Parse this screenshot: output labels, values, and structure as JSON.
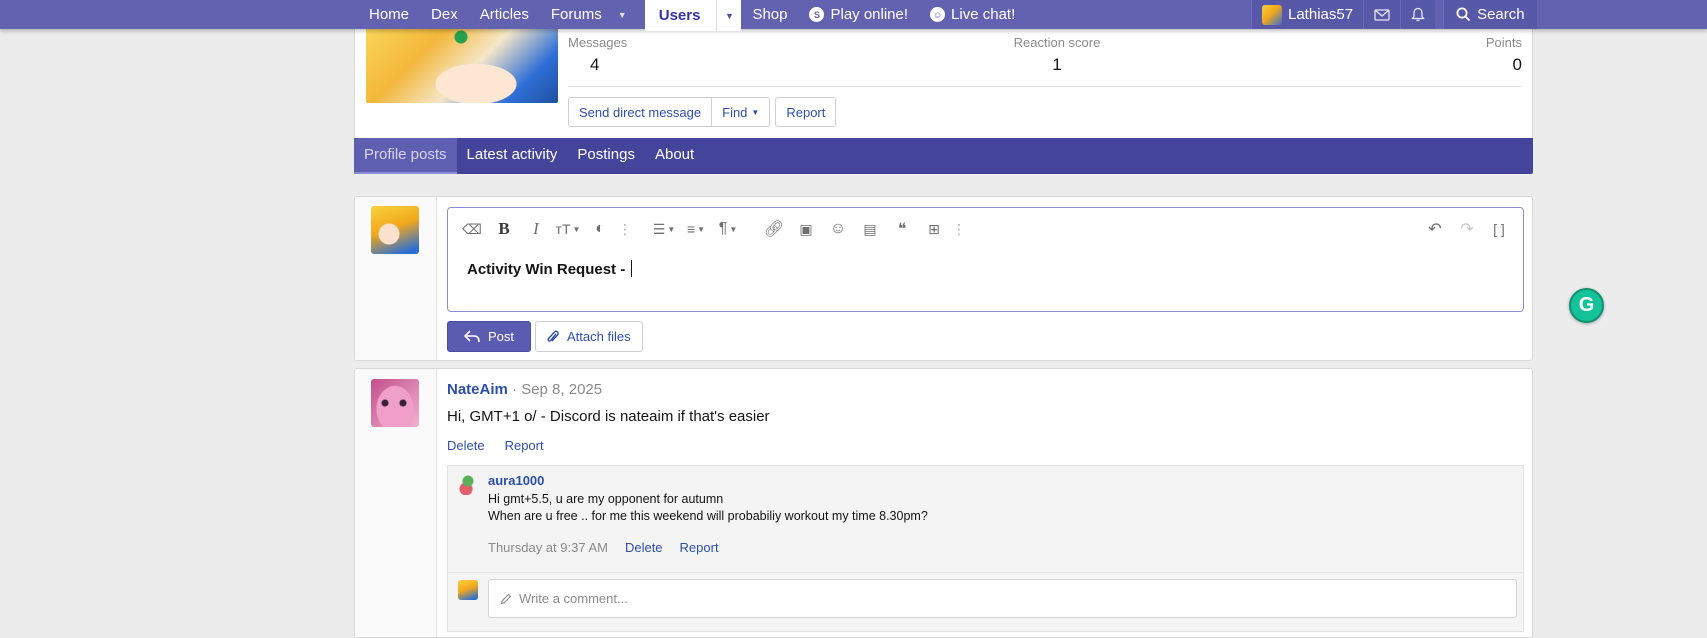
{
  "nav": {
    "tabs": [
      {
        "label": "Home"
      },
      {
        "label": "Dex"
      },
      {
        "label": "Articles"
      },
      {
        "label": "Forums"
      },
      {
        "label": "Users"
      },
      {
        "label": "Shop"
      },
      {
        "label": "Play online!"
      },
      {
        "label": "Live chat!"
      }
    ],
    "username": "Lathias57",
    "search_label": "Search"
  },
  "profile": {
    "stats": [
      {
        "label": "Messages",
        "value": "4"
      },
      {
        "label": "Reaction score",
        "value": "1"
      },
      {
        "label": "Points",
        "value": "0"
      }
    ],
    "buttons": {
      "send_dm": "Send direct message",
      "find": "Find",
      "report": "Report"
    },
    "tabs": [
      {
        "label": "Profile posts",
        "active": true
      },
      {
        "label": "Latest activity"
      },
      {
        "label": "Postings"
      },
      {
        "label": "About"
      }
    ]
  },
  "composer": {
    "text": "Activity Win Request - ",
    "post_label": "Post",
    "attach_label": "Attach files"
  },
  "post": {
    "author": "NateAim",
    "date": "Sep 8, 2025",
    "body": "Hi, GMT+1 o/ - Discord is nateaim if that's easier",
    "actions": {
      "delete": "Delete",
      "report": "Report"
    },
    "comment": {
      "author": "aura1000",
      "line1": "Hi gmt+5.5, u are my opponent for autumn",
      "line2": "When are u free .. for me this weekend will probabiliy workout my time 8.30pm?",
      "time": "Thursday at 9:37 AM",
      "delete": "Delete",
      "report": "Report"
    },
    "write_placeholder": "Write a comment..."
  },
  "colors": {
    "nav_bg": "#6262b0",
    "tabs_bg": "#44449a",
    "link": "#2f4fae",
    "primary_button": "#5b5bb1",
    "grammarly": "#15c39a"
  }
}
